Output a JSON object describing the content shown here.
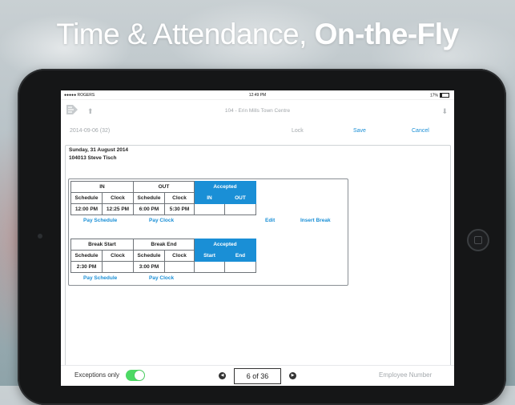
{
  "headline": {
    "regular": "Time & Attendance, ",
    "bold": "On-the-Fly"
  },
  "status": {
    "carrier": "●●●●● ROGERS",
    "time": "12:49 PM",
    "battery": "17%"
  },
  "nav": {
    "title": "104 - Erin Mills Town Centre",
    "logo_icon": "company-logo-icon",
    "up_icon": "arrow-up-icon",
    "down_icon": "arrow-down-icon"
  },
  "subbar": {
    "date": "2014-09-06 (32)",
    "lock": "Lock",
    "save": "Save",
    "cancel": "Cancel"
  },
  "record": {
    "date": "Sunday, 31 August 2014",
    "employee": "104013 Steve Tisch"
  },
  "shift": {
    "headers": {
      "in": "IN",
      "out": "OUT",
      "accepted": "Accepted"
    },
    "sub": {
      "schedule": "Schedule",
      "clock": "Clock",
      "acc_in": "IN",
      "acc_out": "OUT"
    },
    "values": {
      "in_schedule": "12:00 PM",
      "in_clock": "12:25 PM",
      "out_schedule": "6:00 PM",
      "out_clock": "5:30 PM",
      "acc_in": "",
      "acc_out": ""
    },
    "links": {
      "pay_schedule": "Pay Schedule",
      "pay_clock": "Pay Clock",
      "edit": "Edit",
      "insert_break": "Insert Break"
    }
  },
  "break": {
    "headers": {
      "start": "Break Start",
      "end": "Break End",
      "accepted": "Accepted"
    },
    "sub": {
      "schedule": "Schedule",
      "clock": "Clock",
      "acc_start": "Start",
      "acc_end": "End"
    },
    "values": {
      "start_schedule": "2:30 PM",
      "start_clock": "",
      "end_schedule": "3:00 PM",
      "end_clock": "",
      "acc_start": "",
      "acc_end": ""
    },
    "links": {
      "pay_schedule": "Pay Schedule",
      "pay_clock": "Pay Clock"
    }
  },
  "footer": {
    "exceptions_label": "Exceptions only",
    "exceptions_on": true,
    "pager": "6 of 36",
    "employee_placeholder": "Employee Number"
  },
  "colors": {
    "accent": "#1a8fd6",
    "toggle_on": "#4cd964"
  }
}
